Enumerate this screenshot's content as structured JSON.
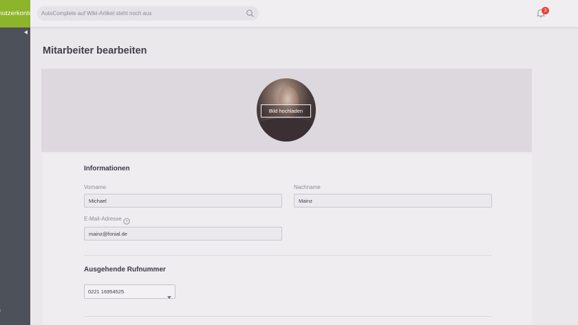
{
  "sidebar": {
    "brand_label": "Benutzerkonto",
    "footer_text": "n"
  },
  "topbar": {
    "search_placeholder": "AutoComplete auf Wiki-Artikel steht noch aus",
    "notification_count": "3"
  },
  "page": {
    "title": "Mitarbeiter bearbeiten"
  },
  "photo": {
    "upload_label": "Bild hochladen"
  },
  "informationen": {
    "heading": "Informationen",
    "vorname_label": "Vorname",
    "vorname_value": "Michael",
    "nachname_label": "Nachname",
    "nachname_value": "Mainz",
    "email_label": "E-Mail-Adresse",
    "email_value": "mainz@fonial.de"
  },
  "rufnummer": {
    "heading": "Ausgehende Rufnummer",
    "selected_value": "0221 16954525"
  },
  "colors": {
    "brand": "#8db52b",
    "sidebar": "#4d5159",
    "badge": "#e8463b"
  }
}
